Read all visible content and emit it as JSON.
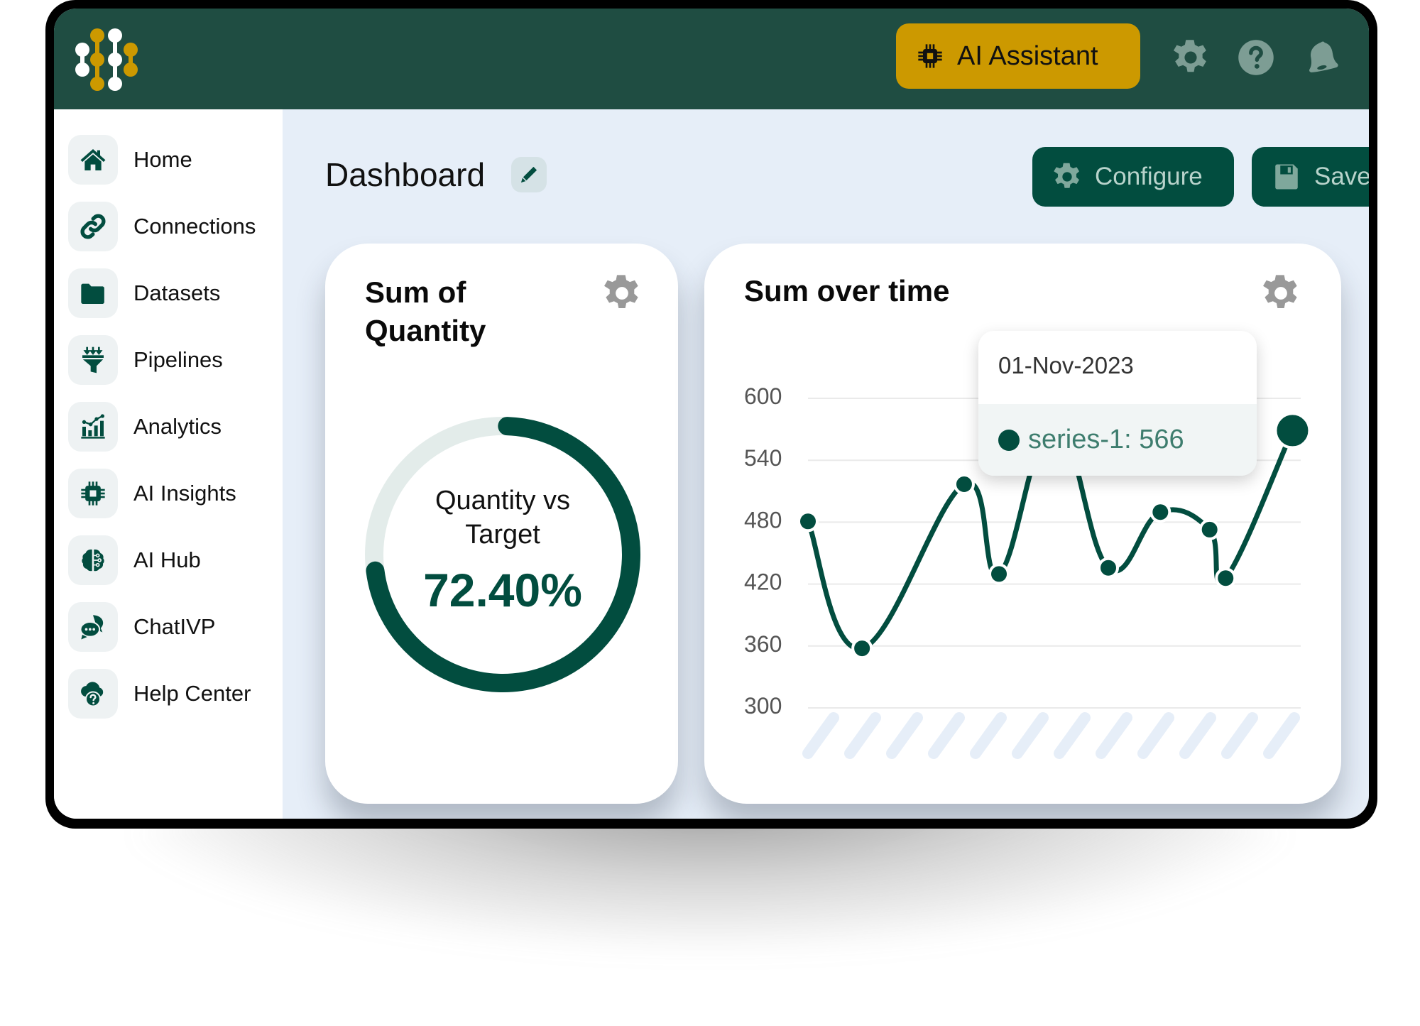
{
  "header": {
    "ai_assistant_label": "AI Assistant",
    "icons": [
      "logo",
      "chip-icon",
      "gear-icon",
      "help-icon",
      "bell-icon"
    ],
    "colors": {
      "header_bg": "#1F4D42",
      "ai_button_bg": "#CC9900",
      "logo_gold": "#CC9900",
      "logo_white": "#FFFFFF",
      "icon_muted": "#7D9D94"
    }
  },
  "sidebar": {
    "items": [
      {
        "label": "Home",
        "icon": "home-icon"
      },
      {
        "label": "Connections",
        "icon": "link-icon"
      },
      {
        "label": "Datasets",
        "icon": "folder-icon"
      },
      {
        "label": "Pipelines",
        "icon": "funnel-icon"
      },
      {
        "label": "Analytics",
        "icon": "chart-icon"
      },
      {
        "label": "AI Insights",
        "icon": "chip-icon"
      },
      {
        "label": "AI Hub",
        "icon": "brain-icon"
      },
      {
        "label": "ChatIVP",
        "icon": "chat-icon"
      },
      {
        "label": "Help Center",
        "icon": "cloud-help-icon"
      }
    ]
  },
  "main": {
    "title": "Dashboard",
    "configure_label": "Configure",
    "save_label": "Save",
    "accent": "#024D3F",
    "background": "#E6EEF8"
  },
  "gauge_card": {
    "title_line1": "Sum of",
    "title_line2": "Quantity",
    "label_line1": "Quantity vs",
    "label_line2": "Target",
    "value_text": "72.40%",
    "value_fraction": 0.724
  },
  "line_card": {
    "title": "Sum over time",
    "tooltip": {
      "date": "01-Nov-2023",
      "series": "series-1",
      "value": 566,
      "text": "series-1: 566"
    }
  },
  "chart_data": {
    "type": "line",
    "title": "Sum over time",
    "xlabel": "",
    "ylabel": "",
    "x_axis_placeholder": "hatched (labels not shown)",
    "yticks": [
      600,
      540,
      480,
      420,
      360,
      300
    ],
    "ylim": [
      300,
      600
    ],
    "grid": true,
    "legend": "none",
    "series": [
      {
        "name": "series-1",
        "x_positions": [
          0,
          0.135,
          0.39,
          0.477,
          0.615,
          0.75,
          0.88,
          1.003,
          1.043,
          1.21
        ],
        "values": [
          478,
          355,
          514,
          427,
          575,
          433,
          487,
          470,
          423,
          566
        ],
        "highlighted_index": 9
      }
    ]
  }
}
